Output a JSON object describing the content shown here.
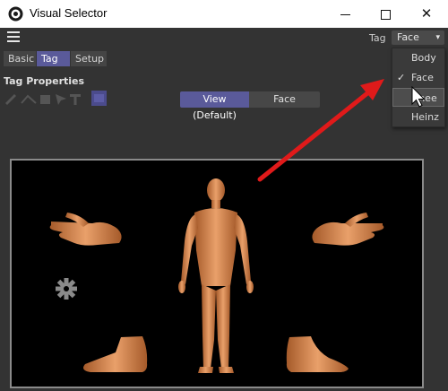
{
  "window": {
    "title": "Visual Selector",
    "controls": {
      "minimize": "—",
      "maximize": "☐",
      "close": "✕"
    }
  },
  "menubar": {
    "menu_icon": "hamburger-icon",
    "tag_label": "Tag",
    "tag_selected": "Face"
  },
  "tabs": [
    {
      "label": "Basic",
      "active": false
    },
    {
      "label": "Tag",
      "active": true
    },
    {
      "label": "Setup",
      "active": false
    }
  ],
  "properties": {
    "title": "Tag Properties",
    "tools": [
      "pen-icon",
      "line-icon",
      "rectangle-icon",
      "pointer-icon",
      "text-icon",
      "image-icon"
    ]
  },
  "view_toggle": {
    "options": [
      {
        "label": "View (Default)",
        "active": true
      },
      {
        "label": "Face",
        "active": false
      }
    ]
  },
  "dropdown": {
    "items": [
      {
        "label": "Body",
        "checked": false,
        "hover": false
      },
      {
        "label": "Face",
        "checked": true,
        "hover": false
      },
      {
        "label": "Knee",
        "checked": false,
        "hover": true
      },
      {
        "label": "Heinz",
        "checked": false,
        "hover": false
      }
    ]
  },
  "colors": {
    "accent": "#5a5a9a",
    "annotation_arrow": "#e01a1a",
    "skin": "#d9915a"
  }
}
